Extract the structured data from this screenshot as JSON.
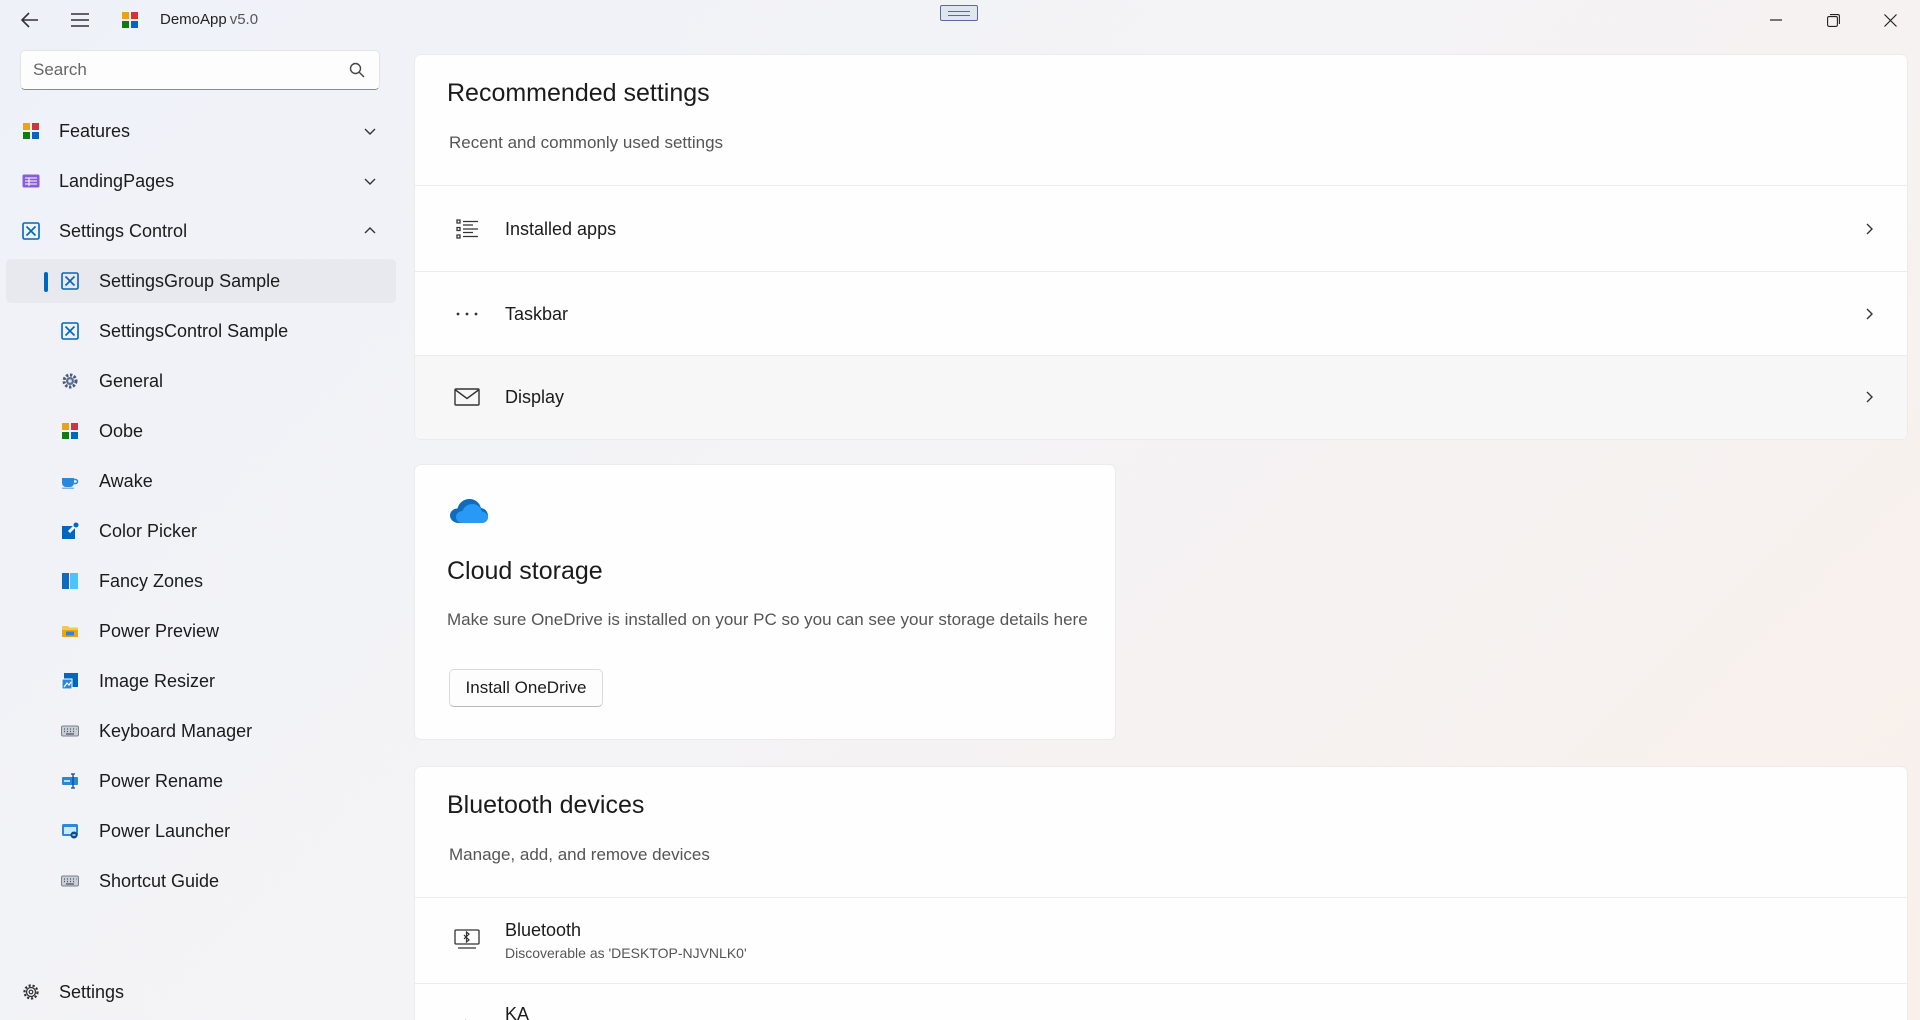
{
  "titlebar": {
    "app_name": "DemoApp",
    "version": "v5.0",
    "back_icon": "back-arrow-icon",
    "menu_icon": "hamburger-icon",
    "minimize_icon": "minimize-icon",
    "restore_icon": "restore-icon",
    "close_icon": "close-icon"
  },
  "sidebar": {
    "search_placeholder": "Search",
    "groups": [
      {
        "label": "Features",
        "icon": "features-icon",
        "expanded": false
      },
      {
        "label": "LandingPages",
        "icon": "landing-pages-icon",
        "expanded": false
      },
      {
        "label": "Settings Control",
        "icon": "settings-control-icon",
        "expanded": true
      }
    ],
    "items": [
      {
        "label": "SettingsGroup Sample",
        "icon": "settings-control-icon",
        "selected": true
      },
      {
        "label": "SettingsControl Sample",
        "icon": "settings-control-icon",
        "selected": false
      },
      {
        "label": "General",
        "icon": "gear-icon",
        "selected": false
      },
      {
        "label": "Oobe",
        "icon": "oobe-icon",
        "selected": false
      },
      {
        "label": "Awake",
        "icon": "coffee-cup-icon",
        "selected": false
      },
      {
        "label": "Color Picker",
        "icon": "color-picker-icon",
        "selected": false
      },
      {
        "label": "Fancy Zones",
        "icon": "fancy-zones-icon",
        "selected": false
      },
      {
        "label": "Power Preview",
        "icon": "folder-preview-icon",
        "selected": false
      },
      {
        "label": "Image Resizer",
        "icon": "image-resizer-icon",
        "selected": false
      },
      {
        "label": "Keyboard Manager",
        "icon": "keyboard-icon",
        "selected": false
      },
      {
        "label": "Power Rename",
        "icon": "rename-icon",
        "selected": false
      },
      {
        "label": "Power Launcher",
        "icon": "launcher-icon",
        "selected": false
      },
      {
        "label": "Shortcut Guide",
        "icon": "keyboard-icon",
        "selected": false
      }
    ],
    "footer": {
      "label": "Settings",
      "icon": "gear-icon"
    }
  },
  "recommended": {
    "title": "Recommended settings",
    "subtitle": "Recent and commonly used settings",
    "rows": [
      {
        "label": "Installed apps",
        "icon": "list-icon"
      },
      {
        "label": "Taskbar",
        "icon": "more-dots-icon"
      },
      {
        "label": "Display",
        "icon": "mail-icon"
      }
    ]
  },
  "cloud": {
    "icon": "onedrive-cloud-icon",
    "title": "Cloud storage",
    "description": "Make sure OneDrive is installed on your PC so you can see your storage details here",
    "button": "Install OneDrive"
  },
  "bluetooth": {
    "title": "Bluetooth devices",
    "subtitle": "Manage, add, and remove devices",
    "rows": [
      {
        "label": "Bluetooth",
        "sub": "Discoverable as 'DESKTOP-NJVNLK0'",
        "icon": "bluetooth-device-icon"
      },
      {
        "label": "KA",
        "sub": "",
        "icon": "device-icon"
      }
    ]
  },
  "colors": {
    "accent": "#0067c0",
    "selected_bg": "#e7e9ee"
  }
}
